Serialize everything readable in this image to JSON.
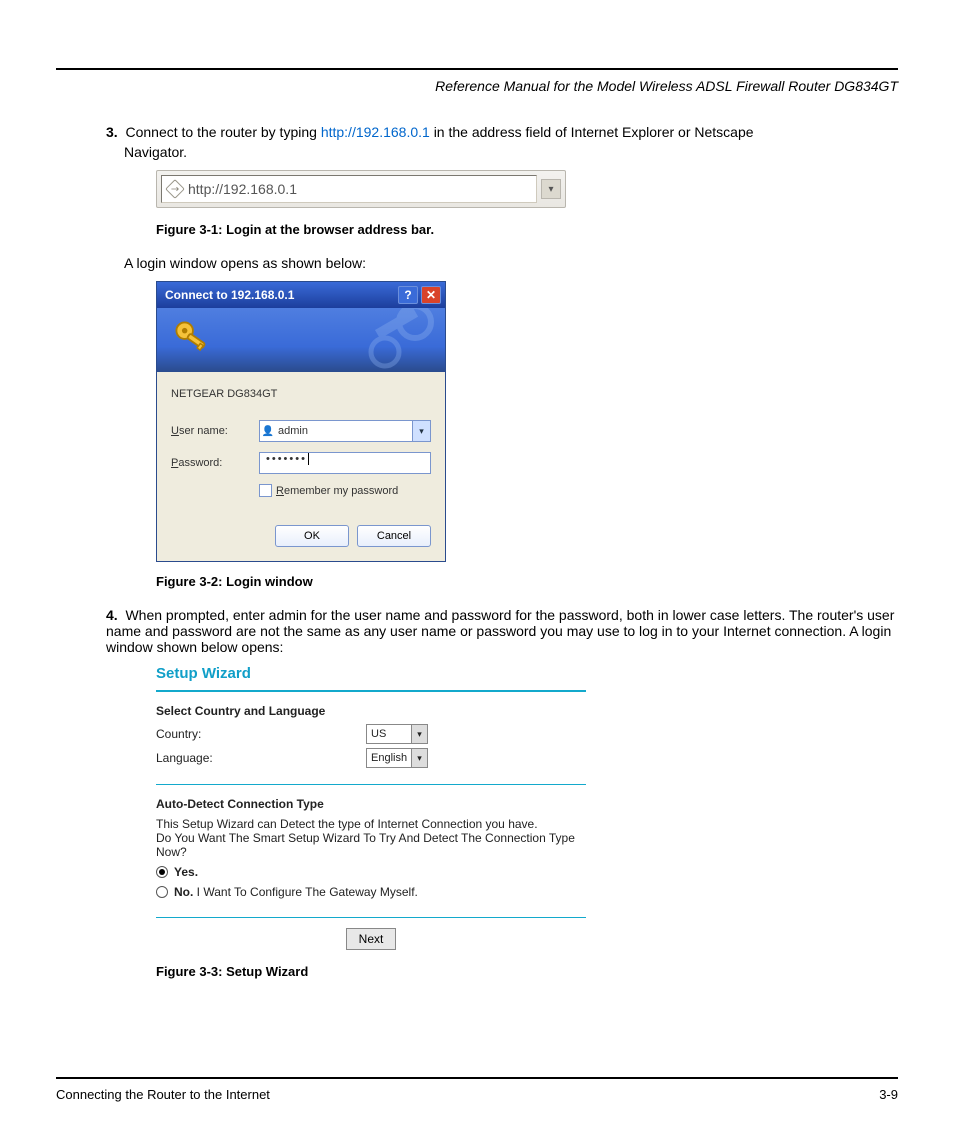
{
  "header": {
    "title": "Reference Manual for the Model Wireless ADSL Firewall Router DG834GT"
  },
  "step3": {
    "prefix": "3.",
    "text_a": "Connect to the router by typing ",
    "url": "http://192.168.0.1",
    "text_b": " in the address field of Internet Explorer or Netscape",
    "text_c": "Navigator."
  },
  "addressbar": {
    "url": "http://192.168.0.1"
  },
  "fig31": "Figure 3-1:  Login at the browser address bar.",
  "login_prompt": "A login window opens as shown below:",
  "dialog": {
    "title": "Connect to 192.168.0.1",
    "realm": "NETGEAR DG834GT",
    "username_label_u": "U",
    "username_label_rest": "ser name:",
    "username_value": "admin",
    "password_label_p": "P",
    "password_label_rest": "assword:",
    "password_mask": "•••••••",
    "remember_r": "R",
    "remember_rest": "emember my password",
    "ok": "OK",
    "cancel": "Cancel"
  },
  "fig32": "Figure 3-2:  Login window",
  "step4": {
    "prefix": "4.",
    "text": "When prompted, enter admin for the user name and password for the password, both in lower case letters. The router's user name and password are not the same as any user name or password you may use to log in to your Internet connection. A login window shown below opens:"
  },
  "wizard": {
    "title": "Setup Wizard",
    "section1": "Select Country and Language",
    "country_label": "Country:",
    "country_value": "US",
    "language_label": "Language:",
    "language_value": "English",
    "section2": "Auto-Detect Connection Type",
    "desc1": "This Setup Wizard can Detect the type of Internet Connection you have.",
    "desc2": "Do You Want The Smart Setup Wizard To Try And Detect The Connection Type Now?",
    "yes": "Yes.",
    "no_bold": "No.",
    "no_rest": " I Want To Configure The Gateway Myself.",
    "next": "Next"
  },
  "fig33": "Figure 3-3:  Setup Wizard",
  "footer": {
    "left": "Connecting the Router to the Internet",
    "right": "3-9"
  }
}
